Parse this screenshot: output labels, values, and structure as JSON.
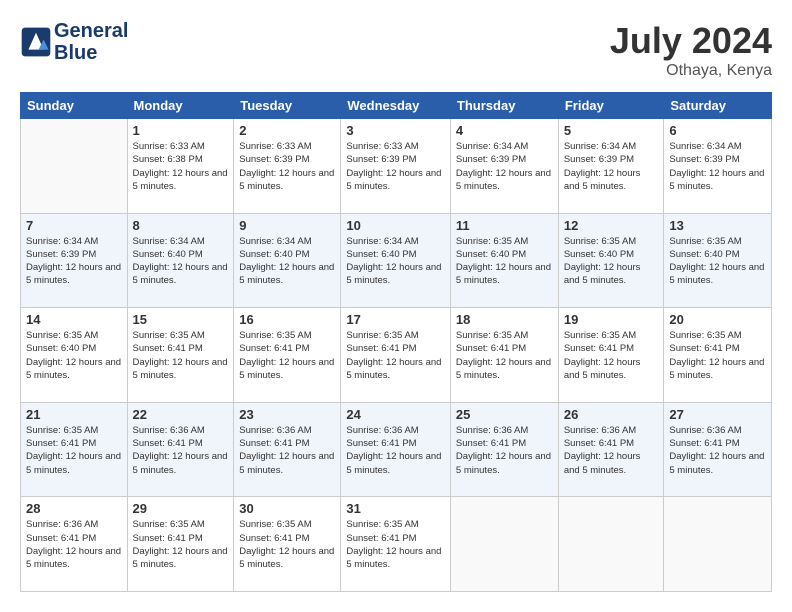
{
  "logo": {
    "line1": "General",
    "line2": "Blue"
  },
  "title": "July 2024",
  "location": "Othaya, Kenya",
  "weekdays": [
    "Sunday",
    "Monday",
    "Tuesday",
    "Wednesday",
    "Thursday",
    "Friday",
    "Saturday"
  ],
  "weeks": [
    [
      {
        "day": "",
        "sunrise": "",
        "sunset": "",
        "daylight": ""
      },
      {
        "day": "1",
        "sunrise": "Sunrise: 6:33 AM",
        "sunset": "Sunset: 6:38 PM",
        "daylight": "Daylight: 12 hours and 5 minutes."
      },
      {
        "day": "2",
        "sunrise": "Sunrise: 6:33 AM",
        "sunset": "Sunset: 6:39 PM",
        "daylight": "Daylight: 12 hours and 5 minutes."
      },
      {
        "day": "3",
        "sunrise": "Sunrise: 6:33 AM",
        "sunset": "Sunset: 6:39 PM",
        "daylight": "Daylight: 12 hours and 5 minutes."
      },
      {
        "day": "4",
        "sunrise": "Sunrise: 6:34 AM",
        "sunset": "Sunset: 6:39 PM",
        "daylight": "Daylight: 12 hours and 5 minutes."
      },
      {
        "day": "5",
        "sunrise": "Sunrise: 6:34 AM",
        "sunset": "Sunset: 6:39 PM",
        "daylight": "Daylight: 12 hours and 5 minutes."
      },
      {
        "day": "6",
        "sunrise": "Sunrise: 6:34 AM",
        "sunset": "Sunset: 6:39 PM",
        "daylight": "Daylight: 12 hours and 5 minutes."
      }
    ],
    [
      {
        "day": "7",
        "sunrise": "Sunrise: 6:34 AM",
        "sunset": "Sunset: 6:39 PM",
        "daylight": "Daylight: 12 hours and 5 minutes."
      },
      {
        "day": "8",
        "sunrise": "Sunrise: 6:34 AM",
        "sunset": "Sunset: 6:40 PM",
        "daylight": "Daylight: 12 hours and 5 minutes."
      },
      {
        "day": "9",
        "sunrise": "Sunrise: 6:34 AM",
        "sunset": "Sunset: 6:40 PM",
        "daylight": "Daylight: 12 hours and 5 minutes."
      },
      {
        "day": "10",
        "sunrise": "Sunrise: 6:34 AM",
        "sunset": "Sunset: 6:40 PM",
        "daylight": "Daylight: 12 hours and 5 minutes."
      },
      {
        "day": "11",
        "sunrise": "Sunrise: 6:35 AM",
        "sunset": "Sunset: 6:40 PM",
        "daylight": "Daylight: 12 hours and 5 minutes."
      },
      {
        "day": "12",
        "sunrise": "Sunrise: 6:35 AM",
        "sunset": "Sunset: 6:40 PM",
        "daylight": "Daylight: 12 hours and 5 minutes."
      },
      {
        "day": "13",
        "sunrise": "Sunrise: 6:35 AM",
        "sunset": "Sunset: 6:40 PM",
        "daylight": "Daylight: 12 hours and 5 minutes."
      }
    ],
    [
      {
        "day": "14",
        "sunrise": "Sunrise: 6:35 AM",
        "sunset": "Sunset: 6:40 PM",
        "daylight": "Daylight: 12 hours and 5 minutes."
      },
      {
        "day": "15",
        "sunrise": "Sunrise: 6:35 AM",
        "sunset": "Sunset: 6:41 PM",
        "daylight": "Daylight: 12 hours and 5 minutes."
      },
      {
        "day": "16",
        "sunrise": "Sunrise: 6:35 AM",
        "sunset": "Sunset: 6:41 PM",
        "daylight": "Daylight: 12 hours and 5 minutes."
      },
      {
        "day": "17",
        "sunrise": "Sunrise: 6:35 AM",
        "sunset": "Sunset: 6:41 PM",
        "daylight": "Daylight: 12 hours and 5 minutes."
      },
      {
        "day": "18",
        "sunrise": "Sunrise: 6:35 AM",
        "sunset": "Sunset: 6:41 PM",
        "daylight": "Daylight: 12 hours and 5 minutes."
      },
      {
        "day": "19",
        "sunrise": "Sunrise: 6:35 AM",
        "sunset": "Sunset: 6:41 PM",
        "daylight": "Daylight: 12 hours and 5 minutes."
      },
      {
        "day": "20",
        "sunrise": "Sunrise: 6:35 AM",
        "sunset": "Sunset: 6:41 PM",
        "daylight": "Daylight: 12 hours and 5 minutes."
      }
    ],
    [
      {
        "day": "21",
        "sunrise": "Sunrise: 6:35 AM",
        "sunset": "Sunset: 6:41 PM",
        "daylight": "Daylight: 12 hours and 5 minutes."
      },
      {
        "day": "22",
        "sunrise": "Sunrise: 6:36 AM",
        "sunset": "Sunset: 6:41 PM",
        "daylight": "Daylight: 12 hours and 5 minutes."
      },
      {
        "day": "23",
        "sunrise": "Sunrise: 6:36 AM",
        "sunset": "Sunset: 6:41 PM",
        "daylight": "Daylight: 12 hours and 5 minutes."
      },
      {
        "day": "24",
        "sunrise": "Sunrise: 6:36 AM",
        "sunset": "Sunset: 6:41 PM",
        "daylight": "Daylight: 12 hours and 5 minutes."
      },
      {
        "day": "25",
        "sunrise": "Sunrise: 6:36 AM",
        "sunset": "Sunset: 6:41 PM",
        "daylight": "Daylight: 12 hours and 5 minutes."
      },
      {
        "day": "26",
        "sunrise": "Sunrise: 6:36 AM",
        "sunset": "Sunset: 6:41 PM",
        "daylight": "Daylight: 12 hours and 5 minutes."
      },
      {
        "day": "27",
        "sunrise": "Sunrise: 6:36 AM",
        "sunset": "Sunset: 6:41 PM",
        "daylight": "Daylight: 12 hours and 5 minutes."
      }
    ],
    [
      {
        "day": "28",
        "sunrise": "Sunrise: 6:36 AM",
        "sunset": "Sunset: 6:41 PM",
        "daylight": "Daylight: 12 hours and 5 minutes."
      },
      {
        "day": "29",
        "sunrise": "Sunrise: 6:35 AM",
        "sunset": "Sunset: 6:41 PM",
        "daylight": "Daylight: 12 hours and 5 minutes."
      },
      {
        "day": "30",
        "sunrise": "Sunrise: 6:35 AM",
        "sunset": "Sunset: 6:41 PM",
        "daylight": "Daylight: 12 hours and 5 minutes."
      },
      {
        "day": "31",
        "sunrise": "Sunrise: 6:35 AM",
        "sunset": "Sunset: 6:41 PM",
        "daylight": "Daylight: 12 hours and 5 minutes."
      },
      {
        "day": "",
        "sunrise": "",
        "sunset": "",
        "daylight": ""
      },
      {
        "day": "",
        "sunrise": "",
        "sunset": "",
        "daylight": ""
      },
      {
        "day": "",
        "sunrise": "",
        "sunset": "",
        "daylight": ""
      }
    ]
  ]
}
